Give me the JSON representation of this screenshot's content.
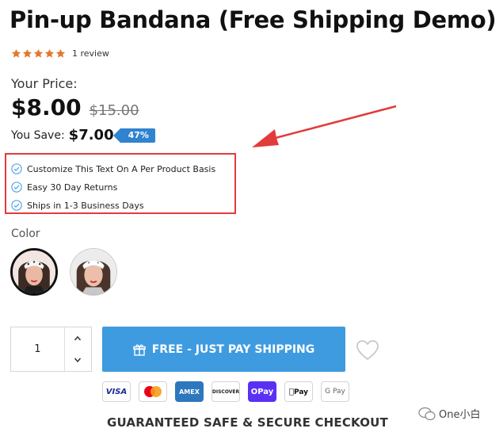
{
  "product": {
    "title": "Pin-up Bandana (Free Shipping Demo)",
    "rating_value": 5,
    "review_count_text": "1 review",
    "star_color": "#e3792d"
  },
  "pricing": {
    "label": "Your Price:",
    "price": "$8.00",
    "compare_price": "$15.00",
    "save_label": "You Save:",
    "save_amount": "$7.00",
    "discount_badge": "47%"
  },
  "features": [
    {
      "icon": "check-circle-icon",
      "text": "Customize This Text On A Per Product Basis"
    },
    {
      "icon": "check-circle-icon",
      "text": "Easy 30 Day Returns"
    },
    {
      "icon": "check-circle-icon",
      "text": "Ships in 1-3 Business Days"
    }
  ],
  "color_option": {
    "label": "Color",
    "swatches": [
      {
        "name": "variant-1",
        "selected": true
      },
      {
        "name": "variant-2",
        "selected": false
      }
    ]
  },
  "quantity": {
    "value": "1"
  },
  "cta": {
    "label": "FREE - JUST PAY SHIPPING",
    "icon": "gift-icon",
    "color": "#3e9be0"
  },
  "wishlist": {
    "icon": "heart-icon"
  },
  "payments": [
    {
      "name": "visa",
      "label": "VISA"
    },
    {
      "name": "mastercard",
      "label": ""
    },
    {
      "name": "amex",
      "label": "AMEX"
    },
    {
      "name": "discover",
      "label": "DISCOVER"
    },
    {
      "name": "opay",
      "label": "OPay"
    },
    {
      "name": "apple-pay",
      "label": "Pay"
    },
    {
      "name": "google-pay",
      "label": "G Pay"
    }
  ],
  "guarantee_text": "GUARANTEED SAFE & SECURE CHECKOUT",
  "watermark": {
    "text": "One小白"
  },
  "annotation": {
    "color": "#e23b3b"
  }
}
